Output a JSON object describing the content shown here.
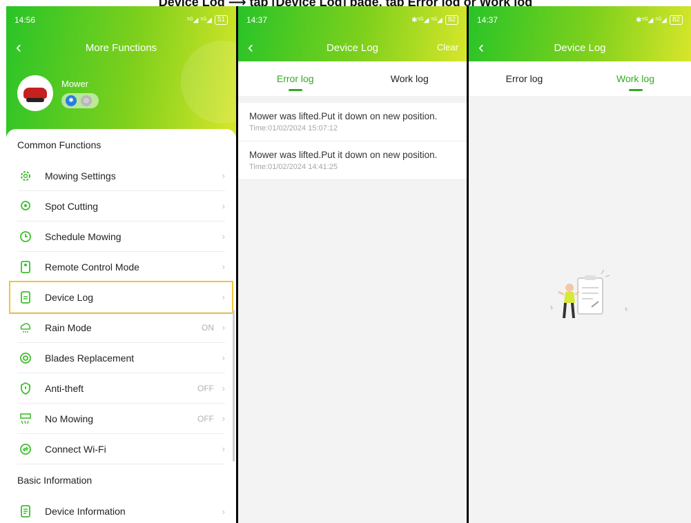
{
  "caption": "Device Log ⟶ tap [Device Log] page, tap Error log or Work log",
  "phone1": {
    "time": "14:56",
    "signal": "⁵ᴳ◢ ⁵ᴳ◢",
    "battery": "51",
    "title": "More Functions",
    "device_name": "Mower",
    "sections": [
      {
        "title": "Common Functions"
      },
      {
        "title": "Basic Information"
      }
    ],
    "items": [
      {
        "label": "Mowing Settings",
        "value": ""
      },
      {
        "label": "Spot Cutting",
        "value": ""
      },
      {
        "label": "Schedule Mowing",
        "value": ""
      },
      {
        "label": "Remote Control Mode",
        "value": ""
      },
      {
        "label": "Device Log",
        "value": ""
      },
      {
        "label": "Rain Mode",
        "value": "ON"
      },
      {
        "label": "Blades Replacement",
        "value": ""
      },
      {
        "label": "Anti-theft",
        "value": "OFF"
      },
      {
        "label": "No Mowing",
        "value": "OFF"
      },
      {
        "label": "Connect Wi-Fi",
        "value": ""
      },
      {
        "label": "Device Information",
        "value": ""
      }
    ],
    "highlight_color": "#f2c33a"
  },
  "phone2": {
    "time": "14:37",
    "signal": "✱⁵ᴳ◢ ⁵ᴳ◢",
    "battery": "82",
    "title": "Device Log",
    "right_action": "Clear",
    "tabs": [
      "Error log",
      "Work log"
    ],
    "active_tab": "Error log",
    "logs": [
      {
        "message": "Mower was lifted.Put it down on new position.",
        "time": "Time:01/02/2024 15:07:12"
      },
      {
        "message": "Mower was lifted.Put it down on new position.",
        "time": "Time:01/02/2024 14:41:25"
      }
    ]
  },
  "phone3": {
    "time": "14:37",
    "signal": "✱⁵ᴳ◢ ⁵ᴳ◢",
    "battery": "82",
    "title": "Device Log",
    "tabs": [
      "Error log",
      "Work log"
    ],
    "active_tab": "Work log"
  },
  "colors": {
    "accent": "#2faa1e",
    "gradient_start": "#28c428",
    "gradient_end": "#d8e62a"
  }
}
